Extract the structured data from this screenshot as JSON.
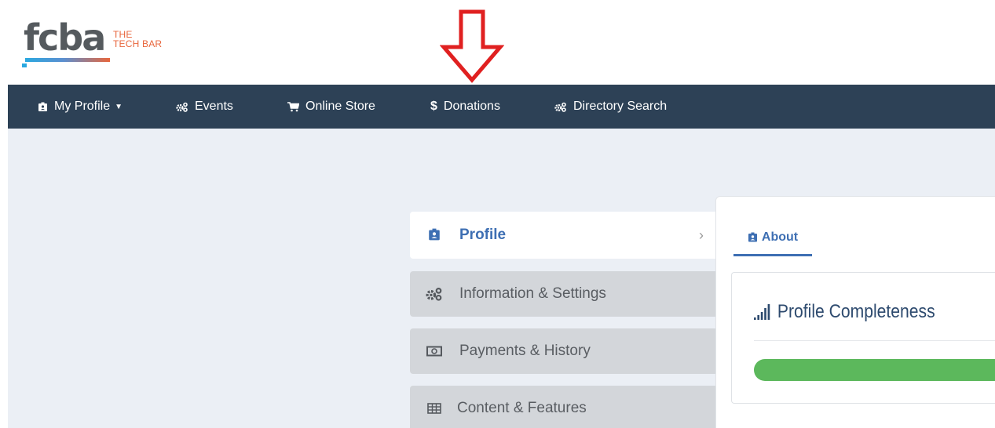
{
  "logo": {
    "word": "fcba",
    "tagline_line1": "THE",
    "tagline_line2": "TECH BAR"
  },
  "nav": {
    "items": [
      {
        "label": "My Profile",
        "icon": "id-badge-icon",
        "has_dropdown": true
      },
      {
        "label": "Events",
        "icon": "gears-icon"
      },
      {
        "label": "Online Store",
        "icon": "cart-icon"
      },
      {
        "label": "Donations",
        "icon": "dollar-icon"
      },
      {
        "label": "Directory Search",
        "icon": "gears-icon"
      }
    ]
  },
  "sidebar": {
    "items": [
      {
        "label": "Profile",
        "icon": "id-badge-icon",
        "active": true
      },
      {
        "label": "Information & Settings",
        "icon": "gears-icon"
      },
      {
        "label": "Payments & History",
        "icon": "money-icon"
      },
      {
        "label": "Content & Features",
        "icon": "table-icon"
      }
    ]
  },
  "panel": {
    "tab_label": "About",
    "card_title": "Profile Completeness",
    "progress": 1.0
  },
  "colors": {
    "nav_bg": "#2d4156",
    "accent": "#3e6fb3",
    "progress": "#5cb85c",
    "arrow": "#e02020"
  }
}
